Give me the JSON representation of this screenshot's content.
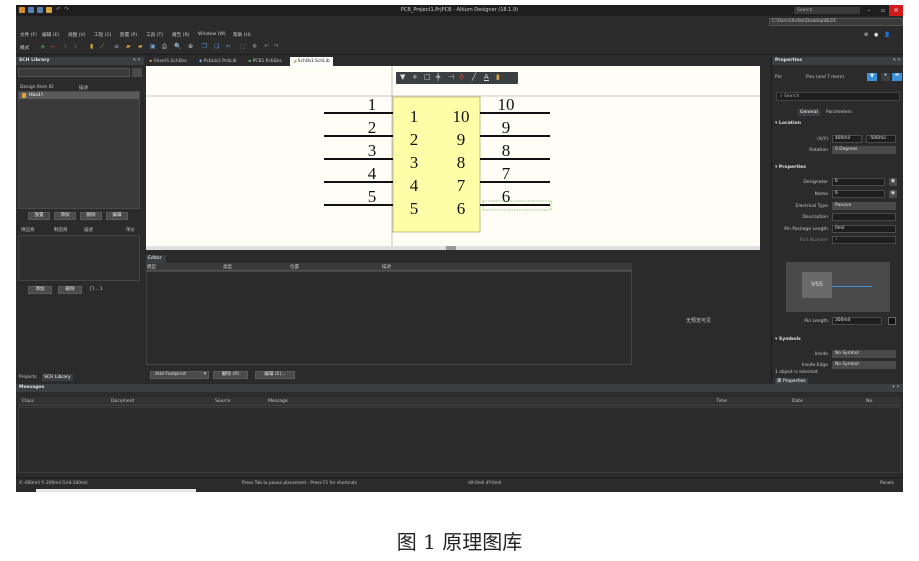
{
  "window": {
    "title": "PCB_Project1.PrjPCB - Altium Designer (18.1.9)",
    "search_placeholder": "Search",
    "path": "C:\\Users\\XuYan\\Desktop\\BLDC"
  },
  "menus": [
    "文件 (F)",
    "编辑 (E)",
    "视图 (V)",
    "工程 (C)",
    "放置 (P)",
    "工具 (T)",
    "报告 (R)",
    "Window (W)",
    "帮助 (H)"
  ],
  "toolbar_mode_label": "模式",
  "sch_library": {
    "title": "SCH Library",
    "col_design_item": "Design Item ID",
    "col_desc": "描述",
    "items": [
      "Hbo1?"
    ],
    "buttons": [
      "放置",
      "添加",
      "删除",
      "编辑"
    ],
    "supplier_cols": [
      "供应商",
      "制造商",
      "描述",
      "单价"
    ],
    "buttons2": [
      "添加",
      "删除"
    ],
    "dropdown_value": "[T...  1"
  },
  "bottom_tabs": [
    "Projects",
    "SCH Library"
  ],
  "doc_tabs": [
    "Sheet1.SchDoc",
    "PcbLib1.PcbLib",
    "PCB1.PcbDoc",
    "Schlib1.SchLib"
  ],
  "active_doc_tab": 3,
  "symbol": {
    "left_pins_outside": [
      "1",
      "2",
      "3",
      "4",
      "5"
    ],
    "left_pins_inside": [
      "1",
      "2",
      "3",
      "4",
      "5"
    ],
    "right_pins_inside": [
      "10",
      "9",
      "8",
      "7",
      "6"
    ],
    "right_pins_outside": [
      "10",
      "9",
      "8",
      "7",
      "6"
    ]
  },
  "editor": {
    "title": "Editor",
    "cols": [
      "模型",
      "类型",
      "位置",
      "描述"
    ],
    "no_preview": "无预览可见",
    "add_footprint": "Add Footprint",
    "delete": "删除 (R)",
    "edit": "编辑 (E)..."
  },
  "messages": {
    "title": "Messages",
    "cols": [
      "Class",
      "Document",
      "Source",
      "Message",
      "Time",
      "Date",
      "No."
    ]
  },
  "status": {
    "coords": "X:-600mil Y:-200mil   Grid:100mil",
    "hint": "Press Tab to pause placement - Press F1 for shortcuts",
    "delta": "dX:0mil dY:0mil",
    "panels": "Panels"
  },
  "properties": {
    "title": "Properties",
    "filter_label": "Pin",
    "filter_value": "Pins (and 7 more)",
    "search_placeholder": "Search",
    "tabs": [
      "General",
      "Parameters"
    ],
    "location_title": "Location",
    "xy_label": "(X/Y)",
    "x": "400mil",
    "y": "-500mil",
    "rotation_label": "Rotation",
    "rotation": "0 Degrees",
    "properties_title": "Properties",
    "designator_label": "Designator",
    "designator": "6",
    "name_label": "Name",
    "name": "6",
    "etype_label": "Electrical Type",
    "etype": "Passive",
    "description_label": "Description",
    "description": "",
    "pkg_len_label": "Pin Package Length",
    "pkg_len": "0mil",
    "part_number_label": "Part Number",
    "part_number": "1",
    "preview_text": "VSS",
    "pin_length_label": "Pin Length",
    "pin_length": "300mil",
    "symbols_title": "Symbols",
    "inside_label": "Inside",
    "inside": "No Symbol",
    "inside_edge_label": "Inside Edge",
    "inside_edge": "No Symbol",
    "selected": "1 object is selected",
    "footer_tab": "Properties"
  },
  "caption": "图 1  原理图库",
  "colors": {
    "bg_dark": "#2b2b2b",
    "accent": "#3a8fd6",
    "symbol_body": "#fffea8",
    "close": "#d11a1a"
  }
}
